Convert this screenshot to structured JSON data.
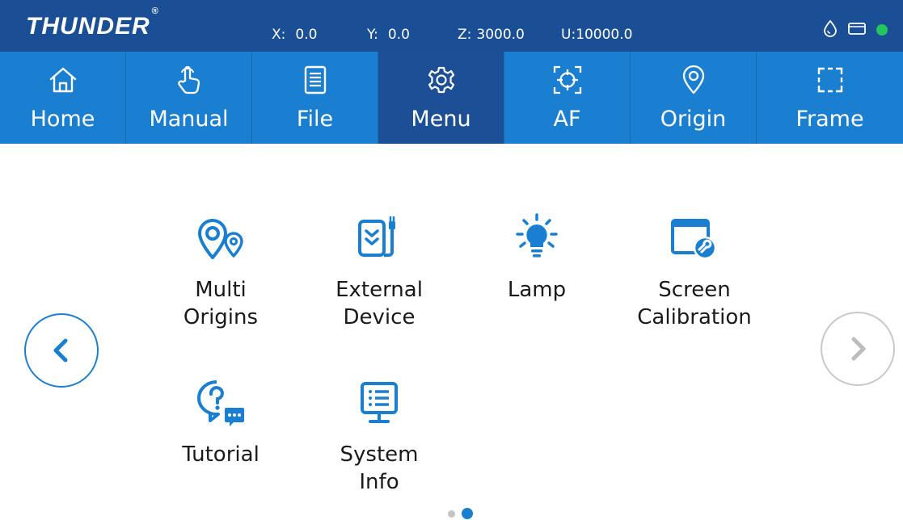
{
  "status_bar": {
    "brand": "THUNDER",
    "registered_mark": "®",
    "coords": [
      {
        "label": "X:",
        "value": "0.0"
      },
      {
        "label": "Y:",
        "value": "0.0"
      },
      {
        "label": "Z:",
        "value": "3000.0"
      },
      {
        "label": "U:",
        "value": "10000.0"
      }
    ],
    "icons": [
      "water-drop-icon",
      "card-slot-icon",
      "connection-status-dot"
    ],
    "connection_color": "#22c55e"
  },
  "nav": {
    "items": [
      {
        "label": "Home",
        "icon": "home-icon"
      },
      {
        "label": "Manual",
        "icon": "hand-pointer-icon"
      },
      {
        "label": "File",
        "icon": "file-icon"
      },
      {
        "label": "Menu",
        "icon": "gear-icon",
        "active": true
      },
      {
        "label": "AF",
        "icon": "autofocus-crosshair-icon"
      },
      {
        "label": "Origin",
        "icon": "location-pin-icon"
      },
      {
        "label": "Frame",
        "icon": "frame-icon"
      }
    ]
  },
  "menu": {
    "tiles": [
      {
        "line1": "Multi",
        "line2": "Origins",
        "icon": "multi-pin-icon"
      },
      {
        "line1": "External",
        "line2": "Device",
        "icon": "external-device-icon"
      },
      {
        "line1": "Lamp",
        "line2": "",
        "icon": "lamp-bulb-icon"
      },
      {
        "line1": "Screen",
        "line2": "Calibration",
        "icon": "screen-calibration-icon"
      },
      {
        "line1": "Tutorial",
        "line2": "",
        "icon": "help-chat-icon"
      },
      {
        "line1": "System",
        "line2": "Info",
        "icon": "system-info-monitor-icon"
      }
    ]
  },
  "pager": {
    "pages": 2,
    "current": 2
  },
  "colors": {
    "status_bar": "#1b4f95",
    "nav_bar": "#1a7fd0",
    "nav_active": "#1c4f96",
    "accent": "#1a7fd0"
  }
}
